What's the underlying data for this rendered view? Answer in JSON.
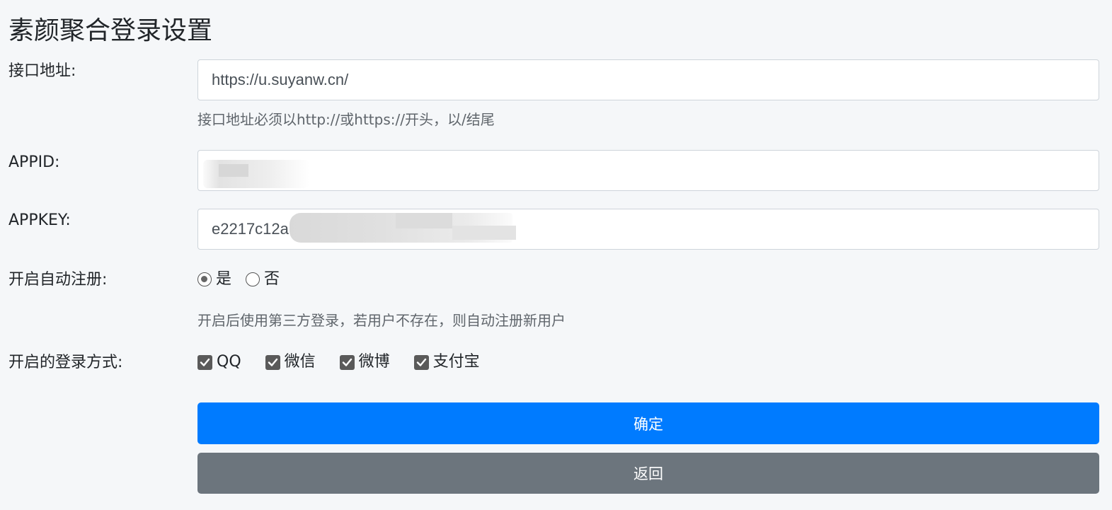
{
  "page": {
    "title": "素颜聚合登录设置"
  },
  "form": {
    "api_url": {
      "label": "接口地址:",
      "value": "https://u.suyanw.cn/",
      "help": "接口地址必须以http://或https://开头，以/结尾"
    },
    "appid": {
      "label": "APPID:",
      "value": ""
    },
    "appkey": {
      "label": "APPKEY:",
      "value": "e2217c12a"
    },
    "auto_register": {
      "label": "开启自动注册:",
      "options": [
        {
          "label": "是",
          "checked": true
        },
        {
          "label": "否",
          "checked": false
        }
      ],
      "help": "开启后使用第三方登录，若用户不存在，则自动注册新用户"
    },
    "login_methods": {
      "label": "开启的登录方式:",
      "options": [
        {
          "label": "QQ",
          "checked": true
        },
        {
          "label": "微信",
          "checked": true
        },
        {
          "label": "微博",
          "checked": true
        },
        {
          "label": "支付宝",
          "checked": true
        }
      ]
    }
  },
  "buttons": {
    "confirm": "确定",
    "back": "返回"
  },
  "colors": {
    "primary": "#007bff",
    "secondary": "#6c757d",
    "background": "#f5f7f9"
  }
}
